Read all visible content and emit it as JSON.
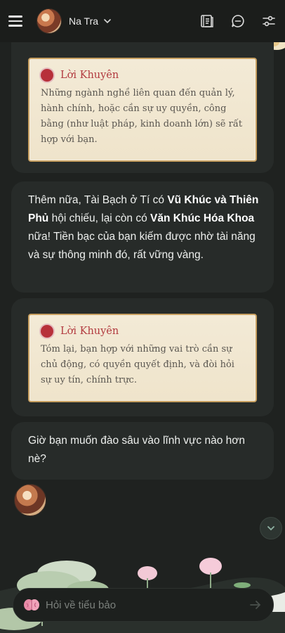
{
  "header": {
    "user_name": "Na Tra",
    "icons": [
      "menu-icon",
      "chevron-down-icon",
      "book-icon",
      "chat-icon",
      "sliders-icon"
    ]
  },
  "messages": [
    {
      "advice_title": "Lời Khuyên",
      "advice_text": "Những ngành nghề liên quan đến quản lý, hành chính, hoặc cần sự uy quyền, công bằng (như luật pháp, kinh doanh lớn) sẽ rất hợp với bạn."
    },
    {
      "text_1": "Thêm nữa, Tài Bạch ở Tí có ",
      "bold_1": "Vũ Khúc và Thiên Phủ",
      "text_2": " hội chiếu, lại còn có ",
      "bold_2": "Văn Khúc Hóa Khoa",
      "text_3": " nữa! Tiền bạc của bạn kiếm được nhờ tài năng và sự thông minh đó, rất vững vàng."
    },
    {
      "advice_title": "Lời Khuyên",
      "advice_text": "Tóm lại, bạn hợp với những vai trò cần sự chủ động, có quyền quyết định, và đòi hỏi sự uy tín, chính trực."
    },
    {
      "text": "Giờ bạn muốn đào sâu vào lĩnh vực nào hơn nè?"
    }
  ],
  "input": {
    "placeholder": "Hỏi về tiểu bảo",
    "value": ""
  },
  "colors": {
    "background": "#1f2220",
    "bubble": "#272b29",
    "advice_bg": "#f3ead6",
    "advice_border": "#c8a061",
    "advice_title": "#b23a3f",
    "accent_dot": "#b7303a"
  }
}
